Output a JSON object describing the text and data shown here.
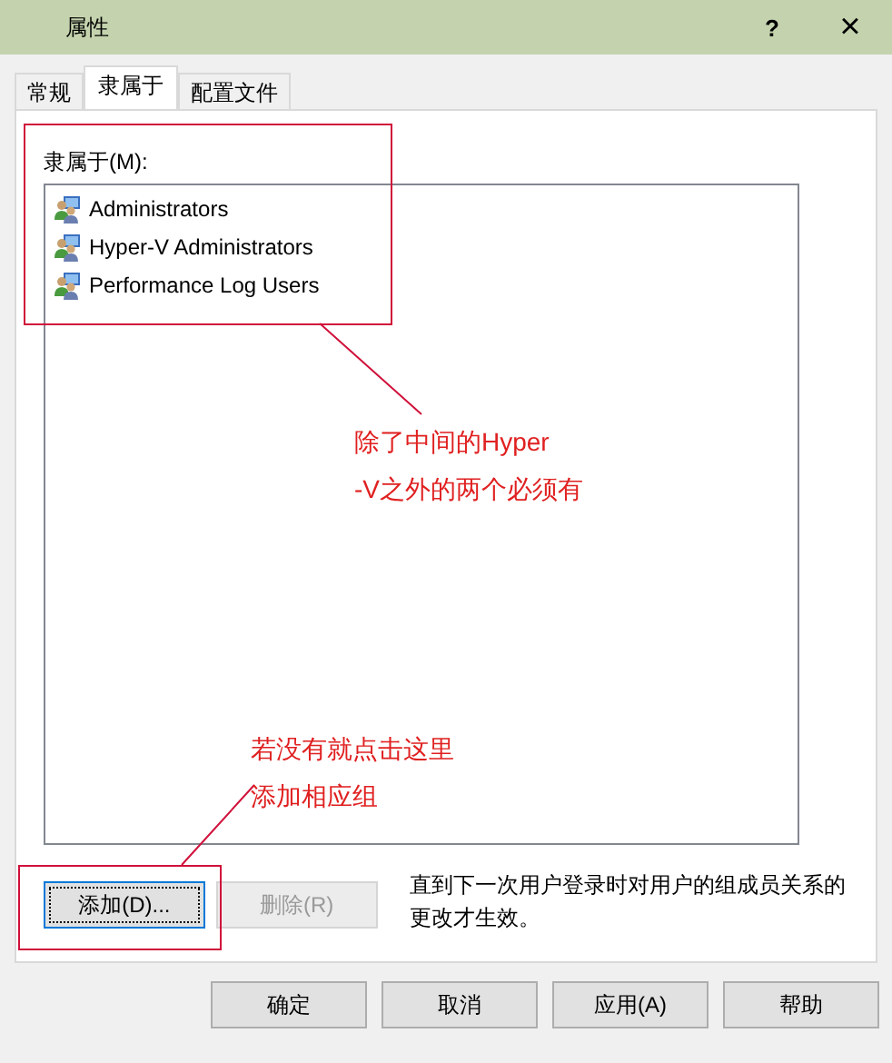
{
  "window": {
    "title": "属性",
    "help": "?",
    "close": "×"
  },
  "tabs": [
    {
      "label": "常规",
      "selected": false
    },
    {
      "label": "隶属于",
      "selected": true
    },
    {
      "label": "配置文件",
      "selected": false
    }
  ],
  "member_of": {
    "label": "隶属于(M):",
    "items": [
      "Administrators",
      "Hyper-V Administrators",
      "Performance Log Users"
    ]
  },
  "actions": [
    {
      "label": "添加(D)...",
      "disabled": false,
      "focused": true
    },
    {
      "label": "删除(R)",
      "disabled": true,
      "focused": false
    }
  ],
  "note": "直到下一次用户登录时对用户的组成员关系的更改才生效。",
  "buttons": [
    "确定",
    "取消",
    "应用(A)",
    "帮助"
  ],
  "annotations": [
    {
      "lines": [
        "除了中间的Hyper",
        "-V之外的两个必须有"
      ]
    },
    {
      "lines": [
        "若没有就点击这里",
        "添加相应组"
      ]
    }
  ]
}
